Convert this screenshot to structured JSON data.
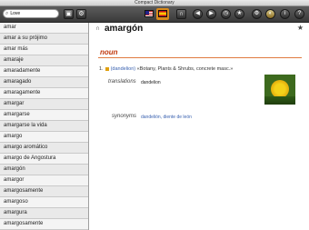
{
  "window": {
    "title": "Compact Dictionary"
  },
  "toolbar": {
    "search_value": "Love",
    "back_label": "◀",
    "forward_label": "▶",
    "history_label": "◷",
    "favorites_label": "★",
    "settings_label": "⚙",
    "info_label": "i",
    "help_label": "?"
  },
  "word_list": [
    "amar",
    "amar a su prójimo",
    "amar más",
    "amaraje",
    "amaradamente",
    "amaragado",
    "amaragamente",
    "amargar",
    "amargarse",
    "amargarse la vida",
    "amargo",
    "amargo aromático",
    "amargo de Angostura",
    "amargón",
    "amargor",
    "amargosamente",
    "amargoso",
    "amargura",
    "amargosamente",
    "amargura"
  ],
  "entry": {
    "headword": "amargón",
    "pos": "noun",
    "sense_number": "1.",
    "sense_link": "(dandelion)",
    "sense_domain": "«Botany, Plants & Shrubs, concrete masc.»",
    "translations_label": "translations",
    "translations_value": "dandelion",
    "synonyms_label": "synonyms",
    "synonyms_value": "dandelión, diente de león"
  }
}
